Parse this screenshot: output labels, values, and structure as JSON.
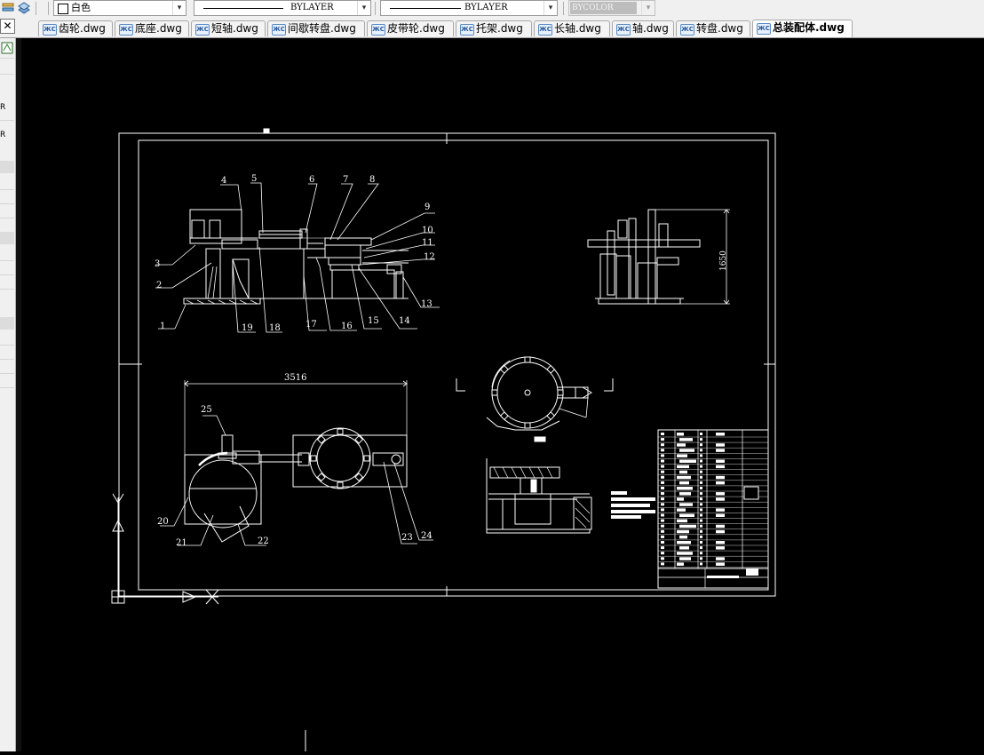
{
  "toolbar": {
    "color_value": "白色",
    "linetype_value": "BYLAYER",
    "lineweight_value": "BYLAYER",
    "plotstyle_value": "BYCOLOR"
  },
  "tabs": [
    {
      "label": "齿轮.dwg",
      "active": false
    },
    {
      "label": "底座.dwg",
      "active": false
    },
    {
      "label": "短轴.dwg",
      "active": false
    },
    {
      "label": "间歇转盘.dwg",
      "active": false
    },
    {
      "label": "皮带轮.dwg",
      "active": false
    },
    {
      "label": "托架.dwg",
      "active": false
    },
    {
      "label": "长轴.dwg",
      "active": false
    },
    {
      "label": "轴.dwg",
      "active": false
    },
    {
      "label": "转盘.dwg",
      "active": false
    },
    {
      "label": "总装配体.dwg",
      "active": true
    }
  ],
  "tab_icon_text": "ЖC",
  "close_glyph": "✕",
  "left_strip": {
    "r1": "R",
    "r2": "R"
  },
  "drawing": {
    "balloons_front": [
      "1",
      "2",
      "3",
      "4",
      "5",
      "6",
      "7",
      "8",
      "9",
      "10",
      "11",
      "12",
      "13",
      "14",
      "15",
      "16",
      "17",
      "18",
      "19"
    ],
    "balloons_top": [
      "20",
      "21",
      "22",
      "23",
      "24",
      "25"
    ],
    "dim_width": "3516",
    "dim_height": "1650"
  },
  "colors": {
    "canvas_bg": "#000000",
    "line": "#ffffff",
    "ui_bg": "#f0f0f0"
  }
}
